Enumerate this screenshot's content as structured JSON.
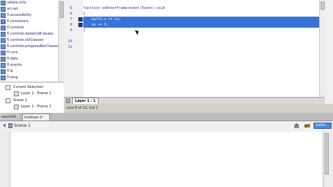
{
  "library_tree": {
    "items": [
      {
        "label": "adobe.utils"
      },
      {
        "label": "air.net"
      },
      {
        "label": "fl.accessibility"
      },
      {
        "label": "fl.containers"
      },
      {
        "label": "fl.controls"
      },
      {
        "label": "fl.controls.dataGridClasses"
      },
      {
        "label": "fl.controls.listClasses"
      },
      {
        "label": "fl.controls.progressBarClasses"
      },
      {
        "label": "fl.core"
      },
      {
        "label": "fl.data"
      },
      {
        "label": "fl.events"
      },
      {
        "label": "fl.ik"
      },
      {
        "label": "fl.lang"
      }
    ]
  },
  "script_navigator": {
    "items": [
      {
        "label": "Current Selection"
      },
      {
        "label": "Layer 1 : Frame 1"
      },
      {
        "label": "Scene 1"
      },
      {
        "label": "Layer 1 : Frame 1"
      }
    ]
  },
  "editor": {
    "line_numbers": [
      "5",
      "6",
      "7",
      "8",
      "9",
      "10",
      "11"
    ],
    "lines": [
      {
        "text": "function onEnterFrame(event:Event):void",
        "selected": false
      },
      {
        "text": "{",
        "selected": false
      },
      {
        "text": "    ball1.x += sx;",
        "selected": true
      },
      {
        "text": "    sx += 1;",
        "selected": true
      },
      {
        "text": "}",
        "selected": false
      },
      {
        "text": "",
        "selected": false
      },
      {
        "text": "",
        "selected": false
      }
    ],
    "script_tab_label": "Layer 1 : 1",
    "status": "Line 8 of 11, Col 1"
  },
  "document_tabs": {
    "left_label": "ssionUtil",
    "active_label": "Untitled-1*"
  },
  "scene_bar": {
    "scene_label": "Scene 1",
    "zoom_value": "100%"
  },
  "colors": {
    "selection": "#3874d8",
    "code_text": "#1f1fa8",
    "accent": "#4a8ad8"
  }
}
